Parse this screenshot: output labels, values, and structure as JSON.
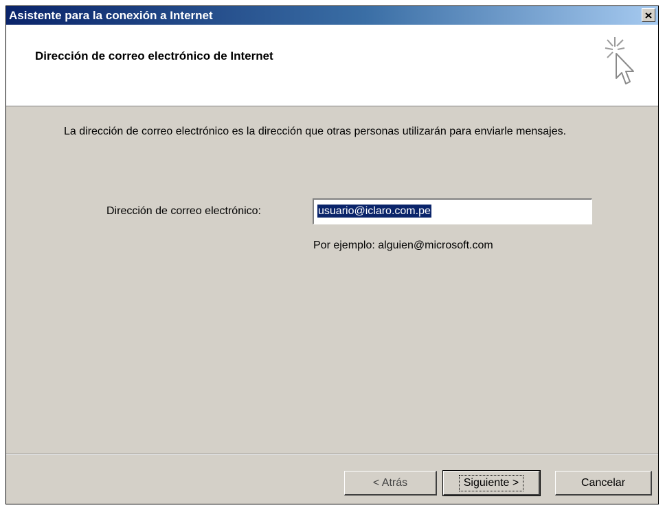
{
  "window": {
    "title": "Asistente para la conexión a Internet"
  },
  "header": {
    "title": "Dirección de correo electrónico de Internet",
    "icon": "wizard-cursor-sparkle-icon"
  },
  "body": {
    "description": "La dirección de correo electrónico es la dirección que otras personas utilizarán para enviarle mensajes.",
    "email_label": "Dirección de correo electrónico:",
    "email_value": "usuario@iclaro.com.pe",
    "example": "Por ejemplo: alguien@microsoft.com"
  },
  "buttons": {
    "back": "< Atrás",
    "next": "Siguiente >",
    "cancel": "Cancelar"
  },
  "colors": {
    "title_bar": "#0a246a",
    "dialog_face": "#d4d0c8",
    "selection": "#0a246a"
  }
}
